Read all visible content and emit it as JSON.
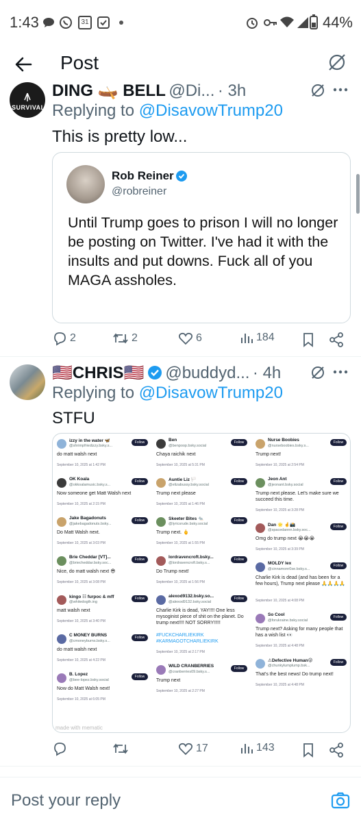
{
  "status_bar": {
    "time": "1:43",
    "calendar_day": "31",
    "battery_pct": "44%"
  },
  "header": {
    "title": "Post"
  },
  "reply1": {
    "name": "DING 🛶 BELL",
    "handle": "@Di...",
    "time": "· 3h",
    "replying_prefix": "Replying to",
    "replying_to": "@DisavowTrump20",
    "text": "This is pretty low...",
    "avatar_text": "SURVIVAL",
    "quote": {
      "name": "Rob Reiner",
      "handle": "@robreiner",
      "text": "Until Trump goes to prison I will no longer be posting on Twitter. I've had it with the insults and put downs. Fuck all of you MAGA assholes."
    },
    "actions": {
      "replies": "2",
      "reposts": "2",
      "likes": "6",
      "views": "184"
    }
  },
  "reply2": {
    "name": "🇺🇸CHRIS🇺🇸",
    "handle": "@buddyd...",
    "time": "· 4h",
    "replying_prefix": "Replying to",
    "replying_to": "@DisavowTrump20",
    "text": "STFU",
    "actions": {
      "replies": "",
      "reposts": "",
      "likes": "17",
      "views": "143"
    }
  },
  "collage": {
    "follow_label": "Follow",
    "columns": [
      [
        {
          "name": "izzy in the water 🦋",
          "handle": "@shrimpfriedizzy.bsky.s...",
          "text": "do matt walsh next",
          "date": "September 10, 2025 at 1:42 PM"
        },
        {
          "name": "OK Koala",
          "handle": "@okkoalamusic.bsky.s...",
          "text": "Now someone get Matt Walsh next",
          "date": "September 10, 2025 at 2:15 PM"
        },
        {
          "name": "Jake Bagadonuts",
          "handle": "@jakebagadonuts.bsky...",
          "text": "Do Matt Walsh next.",
          "date": "September 10, 2025 at 3:03 PM"
        },
        {
          "name": "Brie Cheddar [VT]...",
          "handle": "@briecheddar.bsky.soc...",
          "text": "Nice, do matt walsh next 😎",
          "date": "September 10, 2025 at 3:08 PM"
        },
        {
          "name": "kingo ☷ furpoc & mff",
          "handle": "@whitedogth.ing",
          "text": "matt walsh next",
          "date": "September 10, 2025 at 3:40 PM"
        },
        {
          "name": "C MONEY BURNS",
          "handle": "@cmoneyburns.bsky.s...",
          "text": "do matt walsh next",
          "date": "September 10, 2025 at 4:22 PM"
        },
        {
          "name": "B. Lopez",
          "handle": "@bee-lopez.bsky.social",
          "text": "Now do Matt Walsh next!",
          "date": "September 10, 2025 at 6:05 PM"
        }
      ],
      [
        {
          "name": "Ben",
          "handle": "@benpoop.bsky.social",
          "text": "Chaya raichik next",
          "date": "September 10, 2025 at 5:31 PM"
        },
        {
          "name": "Auntie Liz 🏳️",
          "handle": "@elizabussy.bsky.social",
          "text": "Trump next please",
          "date": "September 10, 2025 at 1:46 PM"
        },
        {
          "name": "Skeeter Bites 🐀",
          "handle": "@lyricsrude.bsky.social",
          "text": "Trump next. 🖕",
          "date": "September 10, 2025 at 1:55 PM"
        },
        {
          "name": "lordravencroft.bsky...",
          "handle": "@lordravencroft.bsky.s...",
          "text": "Do Trump next!",
          "date": "September 10, 2025 at 1:56 PM"
        },
        {
          "name": "alexod9132.bsky.so...",
          "handle": "@alexod9132.bsky.social",
          "text": "Charlie Kirk is dead, YAY!!!! One less mysoginist piece of shit on the planet. Do trump next!!!! NOT SORRY!!!!!",
          "tags": "#FUCKCHARLIEKIRK #KARMAGOTCHARLIEKIRK",
          "date": "September 10, 2025 at 2:17 PM"
        },
        {
          "name": "WILD CRANBERRIES",
          "handle": "@cranberries09.bsky.s...",
          "text": "Trump next",
          "date": "September 10, 2025 at 2:27 PM"
        }
      ],
      [
        {
          "name": "Nurse Boobies",
          "handle": "@nurseboobies.bsky.s...",
          "text": "Trump next!",
          "date": "September 10, 2025 at 2:54 PM"
        },
        {
          "name": "Jeon Ant",
          "handle": "@jeonant.bsky.social",
          "text": "Trump next please. Let's make sure we succeed this time.",
          "date": "September 10, 2025 at 3:28 PM"
        },
        {
          "name": "Dan 🌟 🤞📸",
          "handle": "@spacedannn.bsky.soc...",
          "text": "Omg do trump next 😭😭😭",
          "date": "September 10, 2025 at 3:39 PM"
        },
        {
          "name": "MOLDY lex",
          "handle": "@cinnamonr0se.bsky.s...",
          "text": "Charlie Kirk is dead (and has been for a few hours), Trump next please 🙏🙏🙏🙏",
          "date": "September 10, 2025 at 4:08 PM"
        },
        {
          "name": "So Cool",
          "handle": "@forukraine.bsky.social",
          "text": "Trump next? Asking for many people that has a wish list 👀",
          "date": "September 10, 2025 at 4:48 PM"
        },
        {
          "name": "⚠Defective Human😜",
          "handle": "@chunkylumplump.bsk...",
          "text": "That's the best news! Do trump next!",
          "date": "September 10, 2025 at 4:48 PM"
        }
      ]
    ],
    "watermark": "made with mematic"
  },
  "composer": {
    "placeholder": "Post your reply"
  }
}
